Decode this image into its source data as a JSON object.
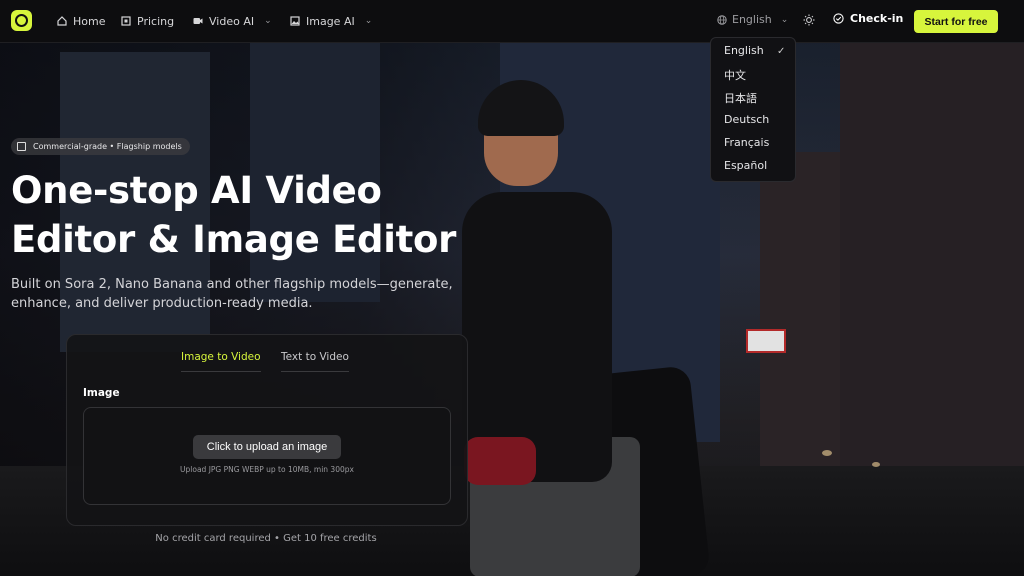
{
  "nav": {
    "home_label": "Home",
    "pricing_label": "Pricing",
    "video_ai_label": "Video AI",
    "image_ai_label": "Image AI",
    "language_label": "English",
    "checkin_label": "Check-in",
    "start_label": "Start for free"
  },
  "language_menu": {
    "options": [
      "English",
      "中文",
      "日本語",
      "Deutsch",
      "Français",
      "Español"
    ],
    "selected": "English"
  },
  "hero": {
    "badge": "Commercial-grade • Flagship models",
    "title_line1": "One-stop AI Video",
    "title_line2": "Editor & Image Editor",
    "subtitle": "Built on Sora 2, Nano Banana and other flagship models—generate, enhance, and deliver production-ready media."
  },
  "card": {
    "tabs": [
      "Image to Video",
      "Text to Video"
    ],
    "active_tab": "Image to Video",
    "field_label": "Image",
    "upload_button": "Click to upload an image",
    "upload_hint": "Upload JPG PNG WEBP up to 10MB, min 300px"
  },
  "footnote": "No credit card required • Get 10 free credits",
  "colors": {
    "accent": "#d7f53c",
    "background": "#0b0b0d"
  }
}
